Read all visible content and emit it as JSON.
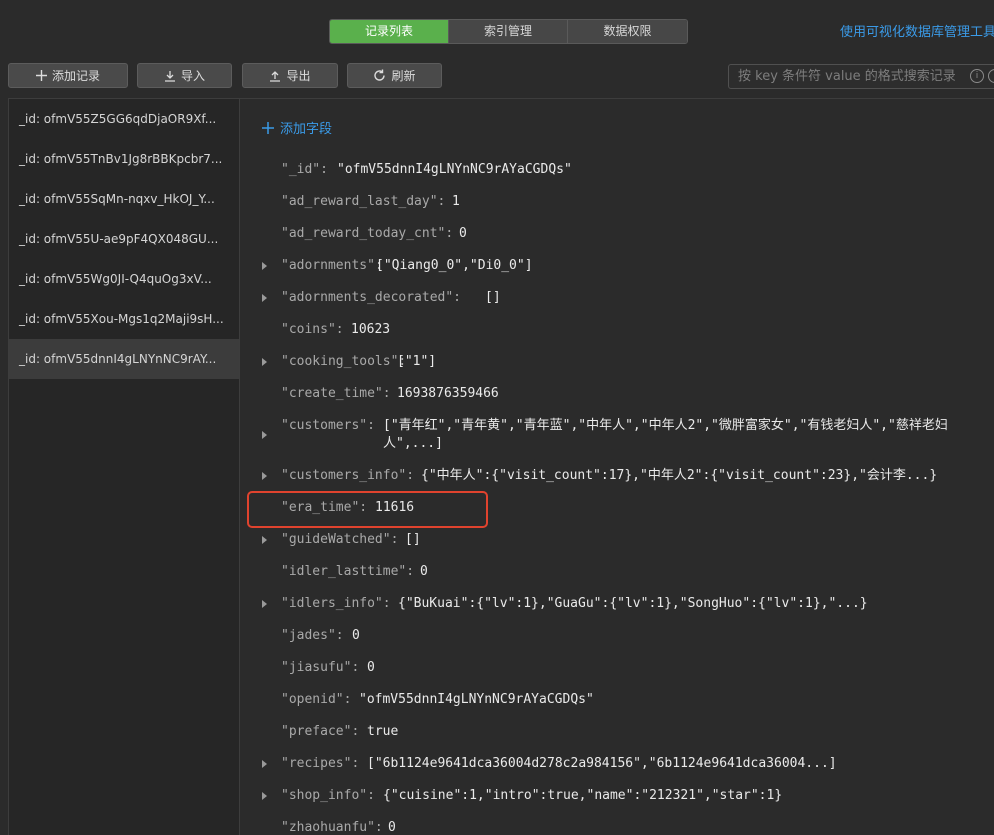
{
  "tabs": [
    "记录列表",
    "索引管理",
    "数据权限"
  ],
  "top_link": "使用可视化数据库管理工具",
  "toolbar": {
    "add_record": "添加记录",
    "import": "导入",
    "export": "导出",
    "refresh": "刷新"
  },
  "search": {
    "placeholder": "按 key 条件符 value 的格式搜索记录"
  },
  "records": [
    "_id: ofmV55Z5GG6qdDjaOR9Xf...",
    "_id: ofmV55TnBv1Jg8rBBKpcbr7...",
    "_id: ofmV55SqMn-nqxv_HkOJ_Y...",
    "_id: ofmV55U-ae9pF4QX048GU...",
    "_id: ofmV55Wg0JI-Q4quOg3xV...",
    "_id: ofmV55Xou-Mgs1q2Maji9sH...",
    "_id: ofmV55dnnI4gLNYnNC9rAY..."
  ],
  "selected_record_index": 6,
  "add_field_label": "添加字段",
  "fields": [
    {
      "key": "\"_id\":",
      "value": "\"ofmV55dnnI4gLNYnNC9rAYaCGDQs\"",
      "expandable": false
    },
    {
      "key": "\"ad_reward_last_day\":",
      "value": "1",
      "expandable": false
    },
    {
      "key": "\"ad_reward_today_cnt\":",
      "value": "0",
      "expandable": false
    },
    {
      "key": "\"adornments\":",
      "value": "[\"Qiang0_0\",\"Di0_0\"]",
      "expandable": true
    },
    {
      "key": "\"adornments_decorated\":",
      "value": "[]",
      "expandable": true
    },
    {
      "key": "\"coins\":",
      "value": "10623",
      "expandable": false
    },
    {
      "key": "\"cooking_tools\":",
      "value": "[\"1\"]",
      "expandable": true
    },
    {
      "key": "\"create_time\":",
      "value": "1693876359466",
      "expandable": false
    },
    {
      "key": "\"customers\":",
      "value": "[\"青年红\",\"青年黄\",\"青年蓝\",\"中年人\",\"中年人2\",\"微胖富家女\",\"有钱老妇人\",\"慈祥老妇人\",...]",
      "expandable": true
    },
    {
      "key": "\"customers_info\":",
      "value": "{\"中年人\":{\"visit_count\":17},\"中年人2\":{\"visit_count\":23},\"会计李...}",
      "expandable": true
    },
    {
      "key": "\"era_time\":",
      "value": "11616",
      "expandable": false
    },
    {
      "key": "\"guideWatched\":",
      "value": "[]",
      "expandable": true
    },
    {
      "key": "\"idler_lasttime\":",
      "value": "0",
      "expandable": false
    },
    {
      "key": "\"idlers_info\":",
      "value": "{\"BuKuai\":{\"lv\":1},\"GuaGu\":{\"lv\":1},\"SongHuo\":{\"lv\":1},\"...}",
      "expandable": true
    },
    {
      "key": "\"jades\":",
      "value": "0",
      "expandable": false
    },
    {
      "key": "\"jiasufu\":",
      "value": "0",
      "expandable": false
    },
    {
      "key": "\"openid\":",
      "value": "\"ofmV55dnnI4gLNYnNC9rAYaCGDQs\"",
      "expandable": false
    },
    {
      "key": "\"preface\":",
      "value": "true",
      "expandable": false
    },
    {
      "key": "\"recipes\":",
      "value": "[\"6b1124e9641dca36004d278c2a984156\",\"6b1124e9641dca36004...]",
      "expandable": true
    },
    {
      "key": "\"shop_info\":",
      "value": "{\"cuisine\":1,\"intro\":true,\"name\":\"212321\",\"star\":1}",
      "expandable": true
    },
    {
      "key": "\"zhaohuanfu\":",
      "value": "0",
      "expandable": false
    }
  ],
  "colors": {
    "accent_green": "#5ab04c",
    "link_blue": "#3b9be8",
    "highlight_red": "#e0432e",
    "background": "#2b2b2b"
  }
}
